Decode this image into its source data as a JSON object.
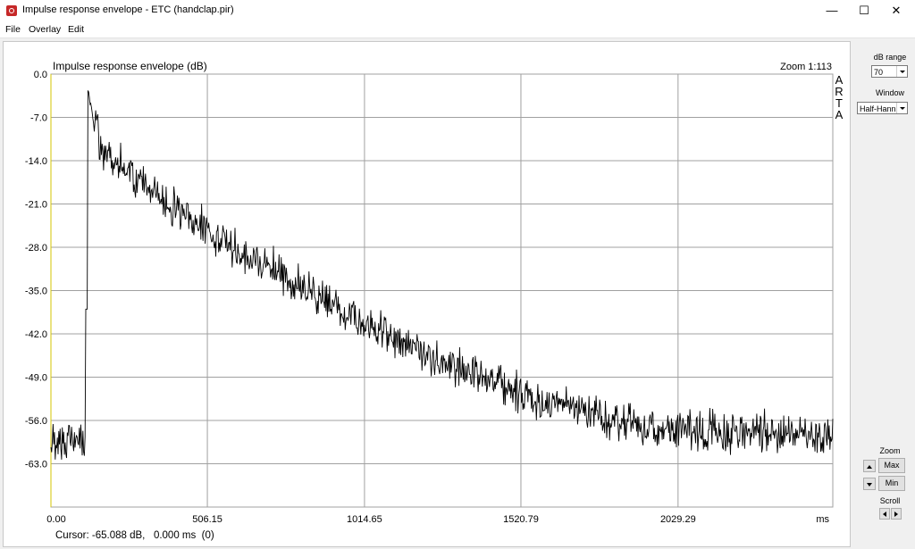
{
  "window": {
    "title": "Impulse response envelope - ETC (handclap.pir)",
    "minimize_glyph": "—",
    "maximize_glyph": "☐",
    "close_glyph": "✕"
  },
  "menu": [
    "File",
    "Overlay",
    "Edit"
  ],
  "chart_data": {
    "type": "line",
    "title": "Impulse response envelope (dB)",
    "zoom_label": "Zoom 1:113",
    "watermark": [
      "A",
      "R",
      "T",
      "A"
    ],
    "xlabel": "ms",
    "x_ticks": [
      "0.00",
      "506.15",
      "1014.65",
      "1520.79",
      "2029.29"
    ],
    "x_tick_values": [
      0,
      506.15,
      1014.65,
      1520.79,
      2029.29
    ],
    "xlim": [
      0,
      2530
    ],
    "y_ticks": [
      "0.0",
      "-7.0",
      "-14.0",
      "-21.0",
      "-28.0",
      "-35.0",
      "-42.0",
      "-49.0",
      "-56.0",
      "-63.0"
    ],
    "ylim": [
      -70,
      0
    ],
    "grid": true,
    "series": [
      {
        "color": "#000000",
        "envelope_points_ms_db": [
          [
            0,
            -59
          ],
          [
            100,
            -59
          ],
          [
            115,
            -60
          ],
          [
            118,
            -2
          ],
          [
            135,
            -7
          ],
          [
            160,
            -12
          ],
          [
            250,
            -16
          ],
          [
            400,
            -22
          ],
          [
            600,
            -28
          ],
          [
            800,
            -34
          ],
          [
            1000,
            -40
          ],
          [
            1200,
            -45
          ],
          [
            1400,
            -49
          ],
          [
            1600,
            -53
          ],
          [
            1800,
            -56
          ],
          [
            2000,
            -57.5
          ],
          [
            2300,
            -58
          ],
          [
            2530,
            -58.5
          ]
        ]
      }
    ],
    "colors": {
      "grid": "#a0a0a0",
      "trace": "#000000",
      "yaxis_marker": "#d4c400"
    }
  },
  "cursor_readout": "Cursor: -65.088 dB,   0.000 ms  (0)",
  "right_panel": {
    "db_range_label": "dB range",
    "db_range_value": "70",
    "window_label": "Window",
    "window_value": "Half-Hann",
    "zoom_label": "Zoom",
    "max_label": "Max",
    "min_label": "Min",
    "scroll_label": "Scroll"
  }
}
